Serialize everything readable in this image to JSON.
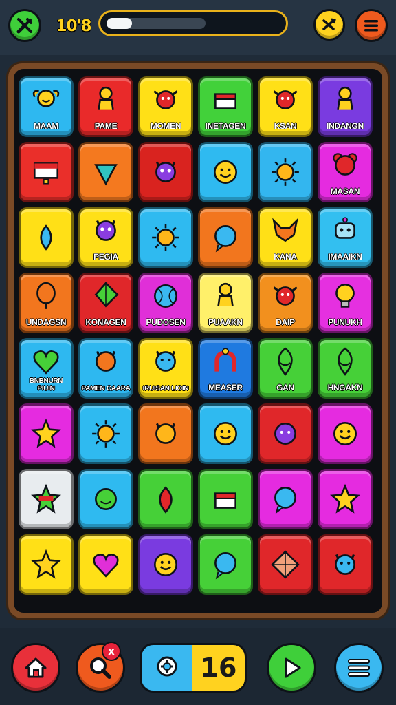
{
  "hud": {
    "level": "10'8",
    "progress": 0.26,
    "moves": "16",
    "hint_badge": "x"
  },
  "icons": {
    "tools": "tools-icon",
    "shuffle": "shuffle-icon",
    "menu": "menu-icon",
    "home": "home-icon",
    "search": "search-icon",
    "booster": "booster-icon",
    "play": "play-icon",
    "list": "list-icon"
  },
  "colors": {
    "gold": "#ffd21f",
    "green_button": "#3fcf3a",
    "orange_button": "#ef5a1e",
    "red_button": "#e8303a",
    "blue_button": "#3ab8f0"
  },
  "tiles": [
    {
      "color": "#2eb8f0",
      "icon": "winged-face",
      "label": "MAAM"
    },
    {
      "color": "#e92a2a",
      "icon": "figure",
      "label": "PAME"
    },
    {
      "color": "#ffe017",
      "icon": "red-creature",
      "label": "MOMEN"
    },
    {
      "color": "#42d13a",
      "icon": "chest",
      "label": "INETAGEN"
    },
    {
      "color": "#ffe017",
      "icon": "red-creature",
      "label": "KSAN"
    },
    {
      "color": "#7a3be0",
      "icon": "figure",
      "label": "INDANGN"
    },
    {
      "color": "#ea2f2a",
      "icon": "flag",
      "label": ""
    },
    {
      "color": "#f4791f",
      "icon": "teal-gem",
      "label": ""
    },
    {
      "color": "#d9231f",
      "icon": "purple-cat",
      "label": ""
    },
    {
      "color": "#2fbaf0",
      "icon": "smile",
      "label": ""
    },
    {
      "color": "#33b6ef",
      "icon": "sun",
      "label": ""
    },
    {
      "color": "#e52be0",
      "icon": "red-bear",
      "label": "MASAN"
    },
    {
      "color": "#ffe017",
      "icon": "blue-drop",
      "label": ""
    },
    {
      "color": "#ffe017",
      "icon": "purple-cat",
      "label": "PEGIA"
    },
    {
      "color": "#2fbaf0",
      "icon": "sun",
      "label": ""
    },
    {
      "color": "#f2761e",
      "icon": "blue-bubble",
      "label": ""
    },
    {
      "color": "#ffe017",
      "icon": "fox",
      "label": "KANA"
    },
    {
      "color": "#33bff0",
      "icon": "robot",
      "label": "IMAAIKN"
    },
    {
      "color": "#f2761e",
      "icon": "balloon",
      "label": "UNDAGSN"
    },
    {
      "color": "#e0272a",
      "icon": "kite",
      "label": "KONAGEN"
    },
    {
      "color": "#e02fd8",
      "icon": "ball",
      "label": "PUDOSEN"
    },
    {
      "color": "#fff06a",
      "icon": "figure",
      "label": "PUAAKN"
    },
    {
      "color": "#f2901e",
      "icon": "red-creature",
      "label": "DAIP"
    },
    {
      "color": "#e530e0",
      "icon": "bulb",
      "label": "PUNUKH"
    },
    {
      "color": "#2eb8f0",
      "icon": "heart",
      "label": "BNBNURN PIUIN"
    },
    {
      "color": "#2eb8f0",
      "icon": "orange-cat",
      "label": "PAMEN CAARA"
    },
    {
      "color": "#ffe017",
      "icon": "blue-cat",
      "label": "IRUISAN LIOIN"
    },
    {
      "color": "#1f7ae0",
      "icon": "magnet",
      "label": "MEASER"
    },
    {
      "color": "#46d038",
      "icon": "leaf-face",
      "label": "GAN"
    },
    {
      "color": "#46d038",
      "icon": "leaf-face",
      "label": "HNGAKN"
    },
    {
      "color": "#e52be0",
      "icon": "star-face",
      "label": ""
    },
    {
      "color": "#2fbaf0",
      "icon": "sun",
      "label": ""
    },
    {
      "color": "#f2761e",
      "icon": "cat-face",
      "label": ""
    },
    {
      "color": "#2fbaf0",
      "icon": "smile",
      "label": ""
    },
    {
      "color": "#e0272a",
      "icon": "purple-blob",
      "label": ""
    },
    {
      "color": "#e52be0",
      "icon": "smile",
      "label": ""
    },
    {
      "color": "#e8ecef",
      "icon": "green-star",
      "label": ""
    },
    {
      "color": "#2fbaf0",
      "icon": "green-face",
      "label": ""
    },
    {
      "color": "#46d038",
      "icon": "red-drop",
      "label": ""
    },
    {
      "color": "#46d038",
      "icon": "chest",
      "label": ""
    },
    {
      "color": "#e52be0",
      "icon": "blue-bubble",
      "label": ""
    },
    {
      "color": "#e52be0",
      "icon": "star-face",
      "label": ""
    },
    {
      "color": "#ffe017",
      "icon": "star-face",
      "label": ""
    },
    {
      "color": "#ffe017",
      "icon": "magenta-heart",
      "label": ""
    },
    {
      "color": "#7a3be0",
      "icon": "smile",
      "label": ""
    },
    {
      "color": "#46d038",
      "icon": "blue-bubble",
      "label": ""
    },
    {
      "color": "#e0272a",
      "icon": "kite-square",
      "label": ""
    },
    {
      "color": "#e0272a",
      "icon": "blue-cat",
      "label": ""
    }
  ]
}
